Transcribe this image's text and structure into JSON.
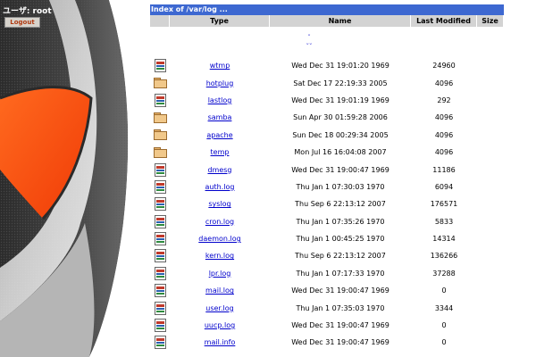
{
  "sidebar": {
    "user_label": "ユーザ: root",
    "logout_label": "Logout"
  },
  "listing": {
    "title": "Index of /var/log ...",
    "columns": [
      "Type",
      "Name",
      "Last Modified",
      "Size"
    ],
    "parent_links": [
      "˘",
      "˘˘"
    ],
    "rows": [
      {
        "type": "file",
        "name": "wtmp",
        "modified": "Wed Dec 31 19:01:20 1969",
        "size": "24960"
      },
      {
        "type": "folder",
        "name": "hotplug",
        "modified": "Sat Dec 17 22:19:33 2005",
        "size": "4096"
      },
      {
        "type": "file",
        "name": "lastlog",
        "modified": "Wed Dec 31 19:01:19 1969",
        "size": "292"
      },
      {
        "type": "folder",
        "name": "samba",
        "modified": "Sun Apr 30 01:59:28 2006",
        "size": "4096"
      },
      {
        "type": "folder",
        "name": "apache",
        "modified": "Sun Dec 18 00:29:34 2005",
        "size": "4096"
      },
      {
        "type": "folder",
        "name": "temp",
        "modified": "Mon Jul 16 16:04:08 2007",
        "size": "4096"
      },
      {
        "type": "file",
        "name": "dmesg",
        "modified": "Wed Dec 31 19:00:47 1969",
        "size": "11186"
      },
      {
        "type": "file",
        "name": "auth.log",
        "modified": "Thu Jan 1 07:30:03 1970",
        "size": "6094"
      },
      {
        "type": "file",
        "name": "syslog",
        "modified": "Thu Sep 6 22:13:12 2007",
        "size": "176571"
      },
      {
        "type": "file",
        "name": "cron.log",
        "modified": "Thu Jan 1 07:35:26 1970",
        "size": "5833"
      },
      {
        "type": "file",
        "name": "daemon.log",
        "modified": "Thu Jan 1 00:45:25 1970",
        "size": "14314"
      },
      {
        "type": "file",
        "name": "kern.log",
        "modified": "Thu Sep 6 22:13:12 2007",
        "size": "136266"
      },
      {
        "type": "file",
        "name": "lpr.log",
        "modified": "Thu Jan 1 07:17:33 1970",
        "size": "37288"
      },
      {
        "type": "file",
        "name": "mail.log",
        "modified": "Wed Dec 31 19:00:47 1969",
        "size": "0"
      },
      {
        "type": "file",
        "name": "user.log",
        "modified": "Thu Jan 1 07:35:03 1970",
        "size": "3344"
      },
      {
        "type": "file",
        "name": "uucp.log",
        "modified": "Wed Dec 31 19:00:47 1969",
        "size": "0"
      },
      {
        "type": "file",
        "name": "mail.info",
        "modified": "Wed Dec 31 19:00:47 1969",
        "size": "0"
      }
    ]
  },
  "colors": {
    "title_bar": "#3d68d1",
    "header_bg": "#d3d3d3",
    "link": "#0000cc",
    "accent_shape": "#ff4a12"
  }
}
